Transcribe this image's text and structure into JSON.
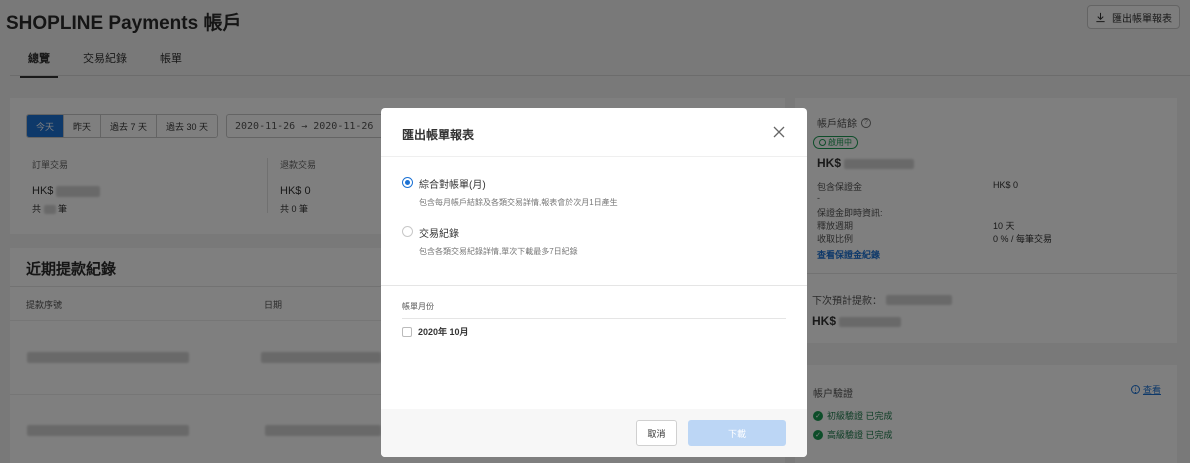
{
  "page": {
    "title": "SHOPLINE Payments 帳戶",
    "export_label": "匯出帳單報表",
    "tabs": [
      "總覽",
      "交易紀錄",
      "帳單"
    ]
  },
  "overview": {
    "ranges": [
      "今天",
      "昨天",
      "過去 7 天",
      "過去 30 天"
    ],
    "date_from": "2020-11-26",
    "date_to": "2020-11-26",
    "orders": {
      "label": "訂單交易",
      "amount_prefix": "HK$",
      "count_prefix": "共",
      "count_suffix": "筆"
    },
    "refunds": {
      "label": "退款交易",
      "amount": "HK$ 0",
      "count": "共 0 筆"
    }
  },
  "payouts": {
    "title": "近期提款紀錄",
    "columns": [
      "提款序號",
      "日期"
    ]
  },
  "account": {
    "title": "帳戶結餘",
    "status": "啟用中",
    "balance_prefix": "HK$",
    "reserve_label": "包含保證金",
    "reserve_value": "HK$ 0",
    "dash": "-",
    "reserve_info": "保證金即時資訊:",
    "release_label": "釋放週期",
    "release_value": "10 天",
    "rate_label": "收取比例",
    "rate_value": "0 % / 每筆交易",
    "reserve_link": "查看保證金紀錄",
    "next_payout_label": "下次預計提款：",
    "next_payout_prefix": "HK$",
    "verify_title": "帳户驗證",
    "verify_link": "查看",
    "verify_items": [
      "初級驗證 已完成",
      "高級驗證 已完成"
    ]
  },
  "modal": {
    "title": "匯出帳單報表",
    "options": [
      {
        "label": "綜合對帳單(月)",
        "desc": "包含每月帳戶結餘及各類交易詳情,報表會於次月1日產生",
        "checked": true
      },
      {
        "label": "交易紀錄",
        "desc": "包含各類交易紀錄詳情,單次下載最多7日紀錄",
        "checked": false
      }
    ],
    "month_title": "帳單月份",
    "month_item": "2020年 10月",
    "cancel_label": "取消",
    "download_label": "下載"
  },
  "colors": {
    "accent": "#1c72d4",
    "success": "#1a9a52"
  },
  "icons": [
    "download-icon",
    "close-icon",
    "help-icon",
    "check-circle-icon",
    "info-icon"
  ]
}
